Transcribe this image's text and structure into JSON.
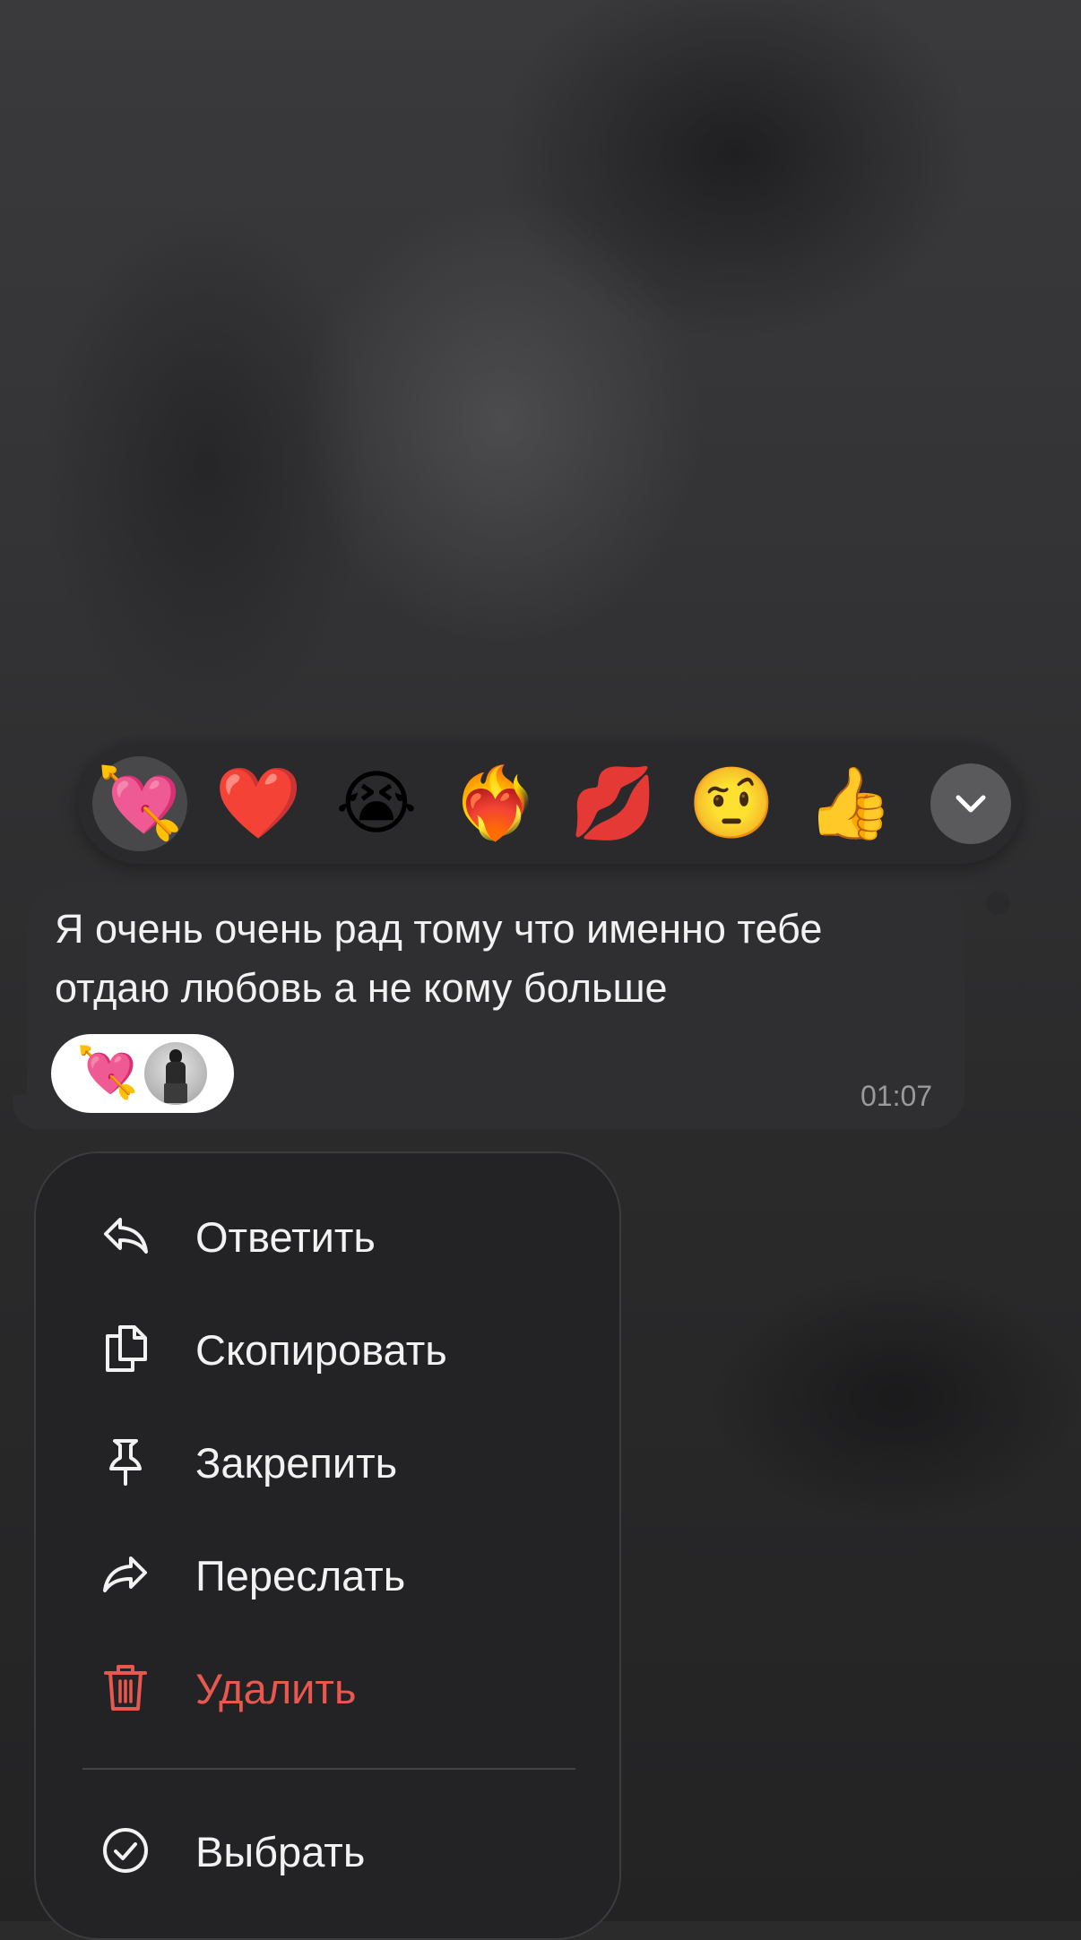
{
  "reactions": {
    "items": [
      {
        "emoji": "💘",
        "name": "heart-with-arrow",
        "selected": true
      },
      {
        "emoji": "❤️",
        "name": "red-heart",
        "selected": false
      },
      {
        "emoji": "😭",
        "name": "loudly-crying-face",
        "selected": false
      },
      {
        "emoji": "❤️‍🔥",
        "name": "heart-on-fire",
        "selected": false
      },
      {
        "emoji": "💋",
        "name": "kiss-mark",
        "selected": false
      },
      {
        "emoji": "🤨",
        "name": "raised-eyebrow-face",
        "selected": false
      },
      {
        "emoji": "👍",
        "name": "thumbs-up",
        "selected": false
      }
    ],
    "expand_icon": "chevron-down-icon"
  },
  "message": {
    "lines": [
      "Я очень очень рад тому что именно тебе",
      "отдаю любовь а не кому больше"
    ],
    "time": "01:07",
    "reaction_chip": {
      "emoji": "💘",
      "avatar": "avatar"
    }
  },
  "menu": {
    "items": [
      {
        "label": "Ответить",
        "icon": "reply-icon"
      },
      {
        "label": "Скопировать",
        "icon": "copy-icon"
      },
      {
        "label": "Закрепить",
        "icon": "pin-icon"
      },
      {
        "label": "Переслать",
        "icon": "forward-icon"
      },
      {
        "label": "Удалить",
        "icon": "trash-icon",
        "danger": true
      },
      {
        "label": "Выбрать",
        "icon": "check-circle-icon"
      }
    ]
  },
  "colors": {
    "danger": "#e9584f",
    "text": "#f2f2f2",
    "menu_bg": "#232325",
    "bubble_bg": "#2f2f31"
  }
}
